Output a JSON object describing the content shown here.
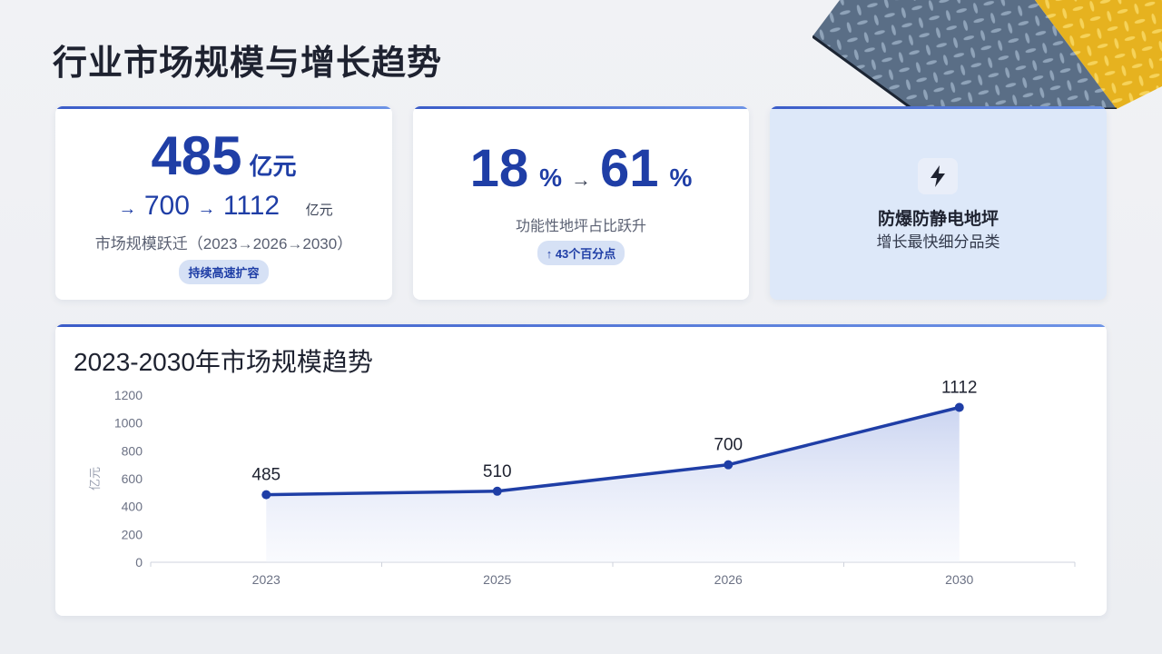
{
  "page": {
    "title": "行业市场规模与增长趋势"
  },
  "card_market": {
    "value": "485",
    "unit": "亿元",
    "steps": [
      "700",
      "1112"
    ],
    "arrow": "→",
    "steps_unit": "亿元",
    "description": "市场规模跃迁（2023→2026→2030）",
    "badge": "持续高速扩容"
  },
  "card_share": {
    "from_value": "18",
    "to_value": "61",
    "percent_sign": "%",
    "arrow": "→",
    "description": "功能性地坪占比跃升",
    "badge": "↑ 43个百分点"
  },
  "card_category": {
    "icon": "lightning-icon",
    "heading": "防爆防静电地坪",
    "subheading": "增长最快细分品类"
  },
  "colors": {
    "accent": "#1f3ea6",
    "accent_light": "#6d93e6",
    "pill_bg": "#d6e1f5",
    "highlight_card_bg": "#dde8f9"
  },
  "chart_data": {
    "type": "line",
    "title": "2023-2030年市场规模趋势",
    "ylabel": "亿元",
    "xlabel": "",
    "categories": [
      "2023",
      "2025",
      "2026",
      "2030"
    ],
    "series": [
      {
        "values": [
          485,
          510,
          700,
          1112
        ]
      }
    ],
    "data_labels": [
      "485",
      "510",
      "700",
      "1112"
    ],
    "yticks": [
      "0",
      "200",
      "400",
      "600",
      "800",
      "1000",
      "1200"
    ],
    "ylim": [
      0,
      1200
    ],
    "grid": false,
    "area_fill": true
  }
}
